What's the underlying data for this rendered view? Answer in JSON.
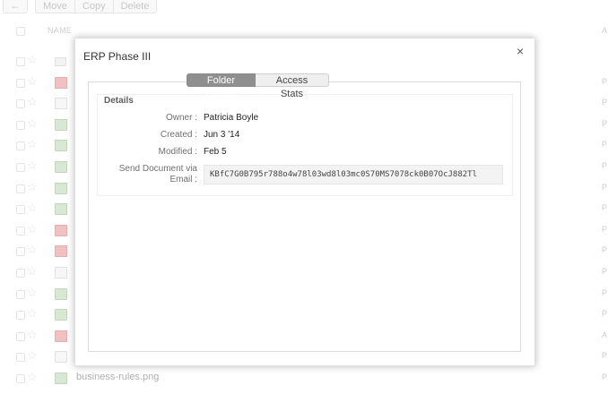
{
  "toolbar": {
    "back_icon": "back-arrow-icon",
    "buttons": [
      "Move",
      "Copy",
      "Delete"
    ]
  },
  "file_list": {
    "header_name": "NAME",
    "header_right": "A",
    "rows": [
      {
        "icon": "folder",
        "name": "",
        "right": ""
      },
      {
        "icon": "pdf",
        "name": "",
        "right": "P"
      },
      {
        "icon": "doc",
        "name": "",
        "right": "P"
      },
      {
        "icon": "img",
        "name": "",
        "right": "P"
      },
      {
        "icon": "img",
        "name": "",
        "right": "P"
      },
      {
        "icon": "img",
        "name": "",
        "right": "P"
      },
      {
        "icon": "img",
        "name": "",
        "right": "P"
      },
      {
        "icon": "img",
        "name": "",
        "right": "P"
      },
      {
        "icon": "pdf",
        "name": "",
        "right": "P"
      },
      {
        "icon": "pdf",
        "name": "",
        "right": "P"
      },
      {
        "icon": "doc",
        "name": "",
        "right": "P"
      },
      {
        "icon": "img",
        "name": "",
        "right": "P"
      },
      {
        "icon": "img",
        "name": "",
        "right": "P"
      },
      {
        "icon": "pdf",
        "name": "",
        "right": "A"
      },
      {
        "icon": "doc",
        "name": "",
        "right": "P"
      },
      {
        "icon": "img",
        "name": "business-rules.png",
        "right": "P"
      }
    ]
  },
  "modal": {
    "title": "ERP Phase III",
    "close_label": "×",
    "tabs": [
      "Folder Details",
      "Access Stats"
    ],
    "active_tab": "Folder Details",
    "details_heading": "Details",
    "owner_label": "Owner :",
    "owner_value": "Patricia Boyle",
    "created_label": "Created :",
    "created_value": "Jun 3 '14",
    "modified_label": "Modified :",
    "modified_value": "Feb 5",
    "email_label_1": "Send Document via",
    "email_label_2": "Email :",
    "email_value": "KBfC7G0B795r788o4w78l03wd8l03mc0S70MS7078ck0B07OcJ882Tl"
  }
}
